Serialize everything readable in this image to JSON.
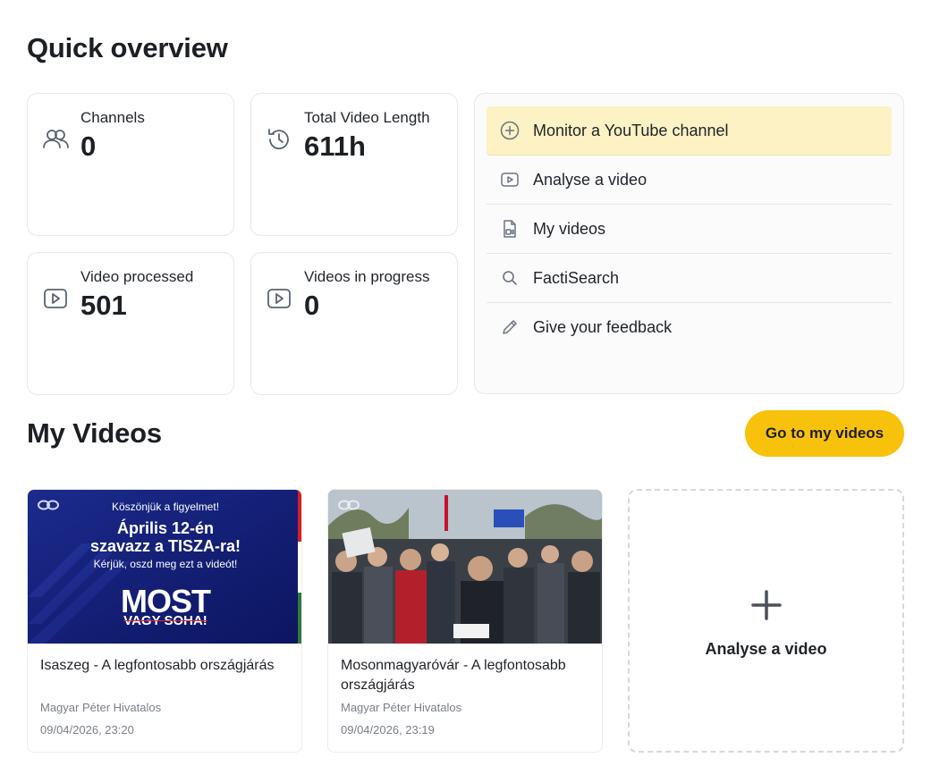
{
  "overview": {
    "title": "Quick overview"
  },
  "stats": [
    {
      "label": "Channels",
      "value": "0",
      "icon": "users-icon"
    },
    {
      "label": "Total Video Length",
      "value": "611h",
      "icon": "history-icon"
    },
    {
      "label": "Video processed",
      "value": "501",
      "icon": "video-icon"
    },
    {
      "label": "Videos in progress",
      "value": "0",
      "icon": "video-icon"
    }
  ],
  "actions": [
    {
      "label": "Monitor a YouTube channel",
      "icon": "plus-circle-icon"
    },
    {
      "label": "Analyse a video",
      "icon": "video-icon"
    },
    {
      "label": "My videos",
      "icon": "file-video-icon"
    },
    {
      "label": "FactiSearch",
      "icon": "search-icon"
    },
    {
      "label": "Give your feedback",
      "icon": "pencil-icon"
    }
  ],
  "my_videos": {
    "title": "My Videos",
    "goto_label": "Go to my videos",
    "accent": "#f8c20c",
    "videos": [
      {
        "title": "Isaszeg - A legfontosabb országjárás",
        "channel": "Magyar Péter Hivatalos",
        "date": "09/04/2026, 23:20",
        "thumb": {
          "line1": "Köszönjük a figyelmet!",
          "line2": "Április 12-én",
          "line3": "szavazz a TISZA-ra!",
          "line4": "Kérjük, oszd meg ezt a videót!",
          "big": "MOST",
          "strike": "VAGY SOHA!"
        }
      },
      {
        "title": "Mosonmagyaróvár - A legfontosabb országjárás",
        "channel": "Magyar Péter Hivatalos",
        "date": "09/04/2026, 23:19"
      }
    ],
    "add_label": "Analyse a video"
  }
}
